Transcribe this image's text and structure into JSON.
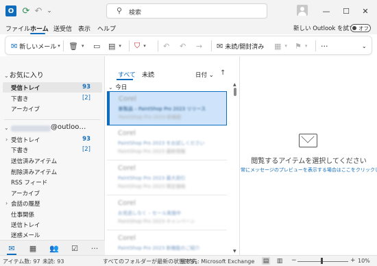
{
  "titlebar": {
    "app_icon": "outlook-icon",
    "app_icon_glyph": "O",
    "search_placeholder": "検索"
  },
  "menu": {
    "items": [
      "ファイル",
      "ホーム",
      "送受信",
      "表示",
      "ヘルプ"
    ],
    "active": "ホーム",
    "new_outlook_label": "新しい Outlook を試す",
    "toggle_state": "オフ"
  },
  "ribbon": {
    "new_mail_label": "新しいメール",
    "read_unread_label": "未読/開封済み"
  },
  "folders": {
    "favorites_header": "お気に入り",
    "favorites": [
      {
        "label": "受信トレイ",
        "count": "93",
        "selected": true
      },
      {
        "label": "下書き",
        "count": "[2]"
      },
      {
        "label": "アーカイブ",
        "count": ""
      }
    ],
    "account_suffix": "@outloo…",
    "account_folders": [
      {
        "label": "受信トレイ",
        "count": "93",
        "caret": true
      },
      {
        "label": "下書き",
        "count": "[2]"
      },
      {
        "label": "送信済みアイテム"
      },
      {
        "label": "削除済みアイテム"
      },
      {
        "label": "RSS フィード"
      },
      {
        "label": "アーカイブ"
      },
      {
        "label": "会話の履歴",
        "caret": true
      },
      {
        "label": "仕事関係"
      },
      {
        "label": "送信トレイ"
      },
      {
        "label": "迷惑メール"
      }
    ]
  },
  "message_list": {
    "tab_all": "すべて",
    "tab_unread": "未読",
    "sort_label": "日付",
    "group_label": "今日",
    "messages": [
      {
        "sender": "Corel",
        "subject": "新製品 – PaintShop Pro 2023 リリース",
        "date": "",
        "preview": "PaintShop Pro 2023 新機能",
        "selected": true
      },
      {
        "sender": "Corel",
        "subject": "PaintShop Pro 2023 をお試しください",
        "date": "",
        "preview": "PaintShop Pro 2023 最新情報"
      },
      {
        "sender": "Corel",
        "subject": "PaintShop Pro 2023 最大割引",
        "date": "",
        "preview": "PaintShop Pro 2023 限定価格"
      },
      {
        "sender": "Corel",
        "subject": "お見逃しなく – セール実施中",
        "date": "",
        "preview": "PaintShop Pro 2023 キャンペーン"
      },
      {
        "sender": "Corel",
        "subject": "PaintShop Pro 2023 新機能のご紹介",
        "date": "",
        "preview": "PaintShop Pro 2023 お知らせ"
      }
    ]
  },
  "reading_pane": {
    "title": "閲覧するアイテムを選択してください",
    "link": "常にメッセージのプレビューを表示する場合はここをクリックしま"
  },
  "statusbar": {
    "item_count": "アイテム数: 97",
    "unread_count": "未読: 93",
    "sync_status": "すべてのフォルダーが最新の状態です。",
    "connection": "接続先: Microsoft Exchange",
    "zoom": "10%"
  }
}
